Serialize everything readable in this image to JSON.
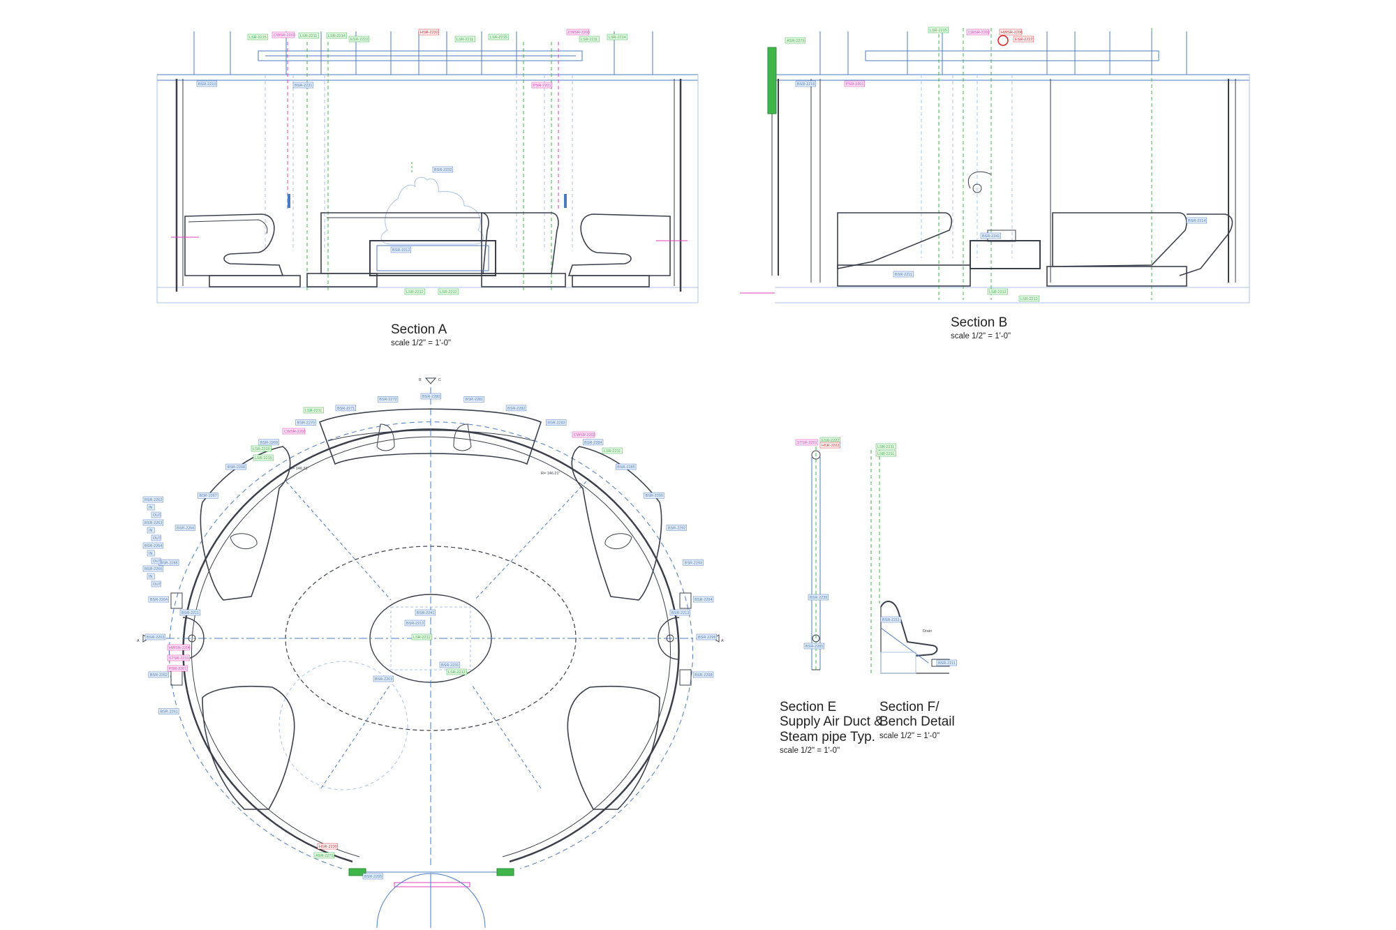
{
  "sheet": {
    "colors": {
      "line": "#3a3f4b",
      "blue": "#4a7bc0",
      "lightblue": "#a9c3e6",
      "green": "#3fb54a",
      "magenta": "#e23fb8",
      "red": "#e02020",
      "tag_blue_bg": "#e6effb",
      "tag_green_bg": "#e8f8e6",
      "tag_mag_bg": "#fde6f6"
    }
  },
  "titles": {
    "section_a": {
      "name": "Section A",
      "scale": "scale 1/2\"   =    1'-0\""
    },
    "section_b": {
      "name": "Section B",
      "scale": "scale 1/2\"   =    1'-0\""
    },
    "section_e": {
      "line1": "Section E",
      "line2": "Supply Air Duct &",
      "line3": "Steam pipe Typ.",
      "scale": "scale 1/2\"   =    1'-0\""
    },
    "section_f": {
      "line1": "Section F/",
      "line2": "Bench Detail",
      "scale": "scale 1/2\"   =    1'-0\""
    }
  },
  "plan": {
    "radius_left": "R= 146.21\"",
    "radius_right": "R= 146.21\"",
    "cut_mark_top": "B",
    "cut_mark_top2": "C",
    "cut_mark_left": "A",
    "cut_mark_right": "A",
    "drain_note": "Drain"
  },
  "tags": {
    "a": [
      {
        "t": "LSR-2215",
        "c": "green"
      },
      {
        "t": "CWSR-2203",
        "c": "magenta"
      },
      {
        "t": "LSR-2211",
        "c": "green"
      },
      {
        "t": "LSR-2214",
        "c": "green"
      },
      {
        "t": "ESR-2222",
        "c": "green"
      },
      {
        "t": "HSR-2230",
        "c": "red"
      },
      {
        "t": "LSR-2211",
        "c": "green"
      },
      {
        "t": "LSR-2215",
        "c": "green"
      },
      {
        "t": "CWSR-2203",
        "c": "magenta"
      },
      {
        "t": "LSR-2211",
        "c": "green"
      },
      {
        "t": "LSR-2214",
        "c": "green"
      },
      {
        "t": "BSR-2210",
        "c": "blue"
      },
      {
        "t": "BSR-2232",
        "c": "blue"
      },
      {
        "t": "BSR-2231",
        "c": "blue"
      },
      {
        "t": "BSR-2212",
        "c": "blue"
      },
      {
        "t": "PSR-2201",
        "c": "magenta"
      },
      {
        "t": "LSR-2212",
        "c": "green"
      },
      {
        "t": "LSR-2212",
        "c": "green"
      }
    ],
    "b": [
      {
        "t": "LSR-2215",
        "c": "green"
      },
      {
        "t": "CWSR-2203",
        "c": "magenta"
      },
      {
        "t": "HWSR-2206",
        "c": "red"
      },
      {
        "t": "ESR-2222",
        "c": "red"
      },
      {
        "t": "ASR-2279",
        "c": "green"
      },
      {
        "t": "BSR-2216",
        "c": "blue"
      },
      {
        "t": "PSR-2201",
        "c": "magenta"
      },
      {
        "t": "BSR-2211",
        "c": "blue"
      },
      {
        "t": "BSR-2241",
        "c": "blue"
      },
      {
        "t": "LSR-2212",
        "c": "green"
      },
      {
        "t": "LSR-2212",
        "c": "green"
      },
      {
        "t": "BSR-2214",
        "c": "blue"
      }
    ],
    "plan": [
      {
        "t": "LSR-2211",
        "c": "green"
      },
      {
        "t": "LSR-2215",
        "c": "green"
      },
      {
        "t": "CWSR-2203",
        "c": "magenta"
      },
      {
        "t": "CWSR-2203",
        "c": "magenta"
      },
      {
        "t": "LSR-2211",
        "c": "green"
      },
      {
        "t": "LSR-2215",
        "c": "green"
      },
      {
        "t": "BSR-2241",
        "c": "blue"
      },
      {
        "t": "BSR-2212",
        "c": "blue"
      },
      {
        "t": "BSR-2203",
        "c": "blue"
      },
      {
        "t": "BSR-2231",
        "c": "blue"
      },
      {
        "t": "LSR-2212",
        "c": "green"
      },
      {
        "t": "LSR-2212",
        "c": "green"
      },
      {
        "t": "BSR-2211",
        "c": "blue"
      },
      {
        "t": "BSR-2213",
        "c": "blue"
      },
      {
        "t": "HWSR-2206",
        "c": "magenta"
      },
      {
        "t": "STSR-2201",
        "c": "magenta"
      },
      {
        "t": "PSR-2201",
        "c": "magenta"
      },
      {
        "t": "HSR-2230",
        "c": "red"
      },
      {
        "t": "ASR-2279",
        "c": "green"
      },
      {
        "t": "BSR-2295",
        "c": "blue"
      }
    ],
    "e": [
      {
        "t": "STSR-2201",
        "c": "magenta"
      },
      {
        "t": "ESR-2222",
        "c": "green"
      },
      {
        "t": "HSR-2222",
        "c": "red"
      },
      {
        "t": "BSR-2235",
        "c": "blue"
      },
      {
        "t": "BSR-2285",
        "c": "blue"
      }
    ],
    "f": [
      {
        "t": "LSR-2211",
        "c": "green"
      },
      {
        "t": "LSR-2211",
        "c": "green"
      },
      {
        "t": "BSR-2211",
        "c": "blue"
      },
      {
        "t": "BSR-2211",
        "c": "blue"
      }
    ],
    "ring": {
      "blue": [
        "BSR-2261",
        "BSR-2262",
        "BSR-2263",
        "BSR-2264",
        "BSR-2265",
        "BSR-2266",
        "BSR-2267",
        "BSR-2268",
        "BSR-2269",
        "BSR-2270",
        "BSR-2271",
        "BSR-2272",
        "BSR-2280",
        "BSR-2281",
        "BSR-2282",
        "BSR-2283",
        "BSR-2284",
        "BSR-2285",
        "BSR-2290",
        "BSR-2292",
        "BSR-2293",
        "BSR-2294",
        "BSR-2296",
        "BSR-2298"
      ],
      "left_stack": [
        "BSR-2262",
        "IN",
        "OUT",
        "BSR-2263",
        "IN",
        "OUT",
        "BSR-2264",
        "IN",
        "OUT",
        "BSR-2266",
        "IN",
        "OUT"
      ]
    }
  }
}
